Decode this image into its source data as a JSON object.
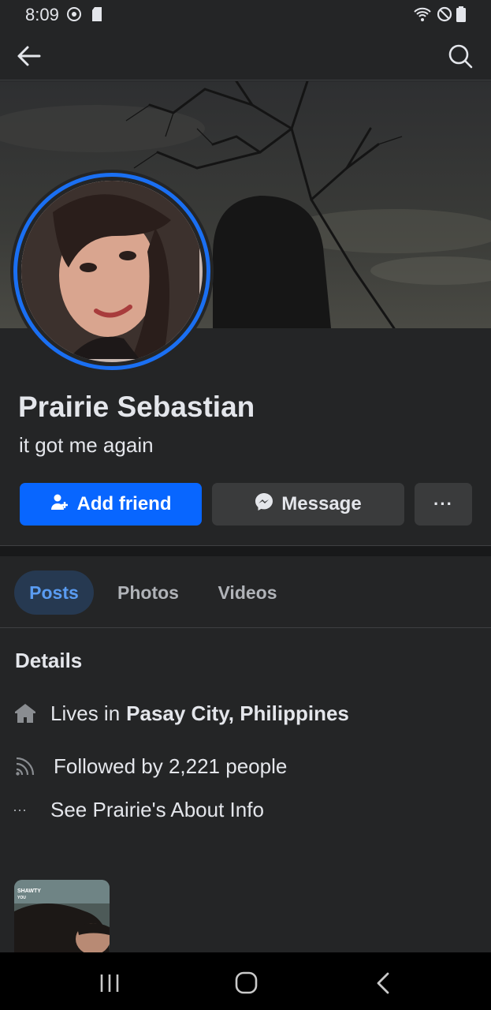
{
  "status_bar": {
    "time": "8:09",
    "left_icons": [
      "sync-icon",
      "sd-card-icon"
    ],
    "right_icons": [
      "wifi-icon",
      "do-not-disturb-icon",
      "battery-icon"
    ]
  },
  "header": {
    "back_icon": "arrow-left-icon",
    "search_icon": "search-icon"
  },
  "profile": {
    "name": "Prairie Sebastian",
    "bio": "it got me again"
  },
  "actions": {
    "add_friend": "Add friend",
    "message": "Message",
    "more": "···"
  },
  "tabs": [
    {
      "label": "Posts",
      "active": true
    },
    {
      "label": "Photos",
      "active": false
    },
    {
      "label": "Videos",
      "active": false
    }
  ],
  "details": {
    "title": "Details",
    "lives_prefix": "Lives in",
    "lives_city": "Pasay City, Philippines",
    "followed": "Followed by 2,221 people",
    "about_dots": "···",
    "about": "See Prairie's About Info"
  },
  "thumbnail": {
    "caption_top": "SHAWTY",
    "caption_bottom": "YOU"
  },
  "colors": {
    "background": "#242526",
    "primary_button": "#0866ff",
    "secondary_button": "#3a3b3c",
    "avatar_ring": "#1a6ff2",
    "active_tab_bg": "#263951",
    "active_tab_text": "#5a9cf2"
  }
}
